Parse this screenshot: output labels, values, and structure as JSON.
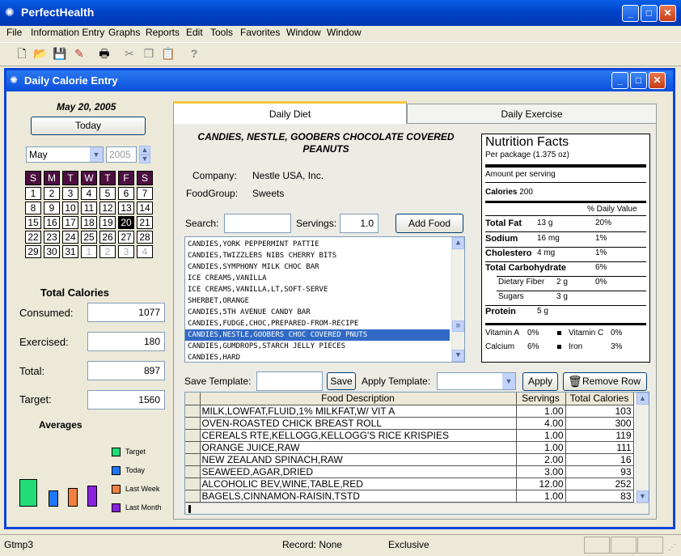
{
  "app": {
    "title": "PerfectHealth"
  },
  "menu": [
    "File",
    "Information Entry",
    "Graphs",
    "Reports",
    "Edit",
    "Tools",
    "Favorites",
    "Window",
    "Window"
  ],
  "child": {
    "title": "Daily Calorie Entry"
  },
  "date": {
    "label": "May 20, 2005",
    "today_button": "Today",
    "month": "May",
    "year": "2005"
  },
  "calendar": {
    "days_header": [
      "S",
      "M",
      "T",
      "W",
      "T",
      "F",
      "S"
    ],
    "weeks": [
      [
        "1",
        "2",
        "3",
        "4",
        "5",
        "6",
        "7"
      ],
      [
        "8",
        "9",
        "10",
        "11",
        "12",
        "13",
        "14"
      ],
      [
        "15",
        "16",
        "17",
        "18",
        "19",
        "20",
        "21"
      ],
      [
        "22",
        "23",
        "24",
        "25",
        "26",
        "27",
        "28"
      ],
      [
        "29",
        "30",
        "31",
        "1",
        "2",
        "3",
        "4"
      ]
    ],
    "selected": "20"
  },
  "totals": {
    "heading": "Total Calories",
    "consumed_label": "Consumed:",
    "consumed": "1077",
    "exercised_label": "Exercised:",
    "exercised": "180",
    "total_label": "Total:",
    "total": "897",
    "target_label": "Target:",
    "target": "1560"
  },
  "averages": {
    "heading": "Averages",
    "legend": [
      {
        "label": "Target",
        "color": "#22dd77"
      },
      {
        "label": "Today",
        "color": "#1e78ff"
      },
      {
        "label": "Last Week",
        "color": "#f08040"
      },
      {
        "label": "Last Month",
        "color": "#8822dd"
      }
    ],
    "levels": [
      1.0,
      0.6,
      0.69,
      0.77
    ]
  },
  "tabs": [
    "Daily Diet",
    "Daily Exercise"
  ],
  "food": {
    "name": "CANDIES, NESTLE, GOOBERS CHOCOLATE COVERED PEANUTS",
    "company_label": "Company:",
    "company": "Nestle USA, Inc.",
    "foodgroup_label": "FoodGroup:",
    "foodgroup": "Sweets"
  },
  "search": {
    "label": "Search:",
    "value": "",
    "servings_label": "Servings:",
    "servings": "1.0",
    "add_button": "Add Food"
  },
  "food_list": [
    "CANDIES,YORK PEPPERMINT PATTIE",
    "CANDIES,TWIZZLERS NIBS CHERRY BITS",
    "CANDIES,SYMPHONY MILK CHOC BAR",
    "ICE CREAMS,VANILLA",
    "ICE CREAMS,VANILLA,LT,SOFT-SERVE",
    "SHERBET,ORANGE",
    "CANDIES,5TH AVENUE CANDY BAR",
    "CANDIES,FUDGE,CHOC,PREPARED-FROM-RECIPE",
    "CANDIES,NESTLE,GOOBERS CHOC COVERED PNUTS",
    "CANDIES,GUMDROPS,STARCH JELLY PIECES",
    "CANDIES,HARD"
  ],
  "food_list_selected": 8,
  "nutrition": {
    "title": "Nutrition Facts",
    "per_package": "Per package (1.375 oz)",
    "amount_per": "Amount per serving",
    "calories_label": "Calories",
    "calories": "200",
    "dv_header": "% Daily Value",
    "rows": [
      {
        "label": "Total Fat",
        "amount": "13 g",
        "dv": "20%",
        "bold": true,
        "indent": false
      },
      {
        "label": "Sodium",
        "amount": "16 mg",
        "dv": "1%",
        "bold": true,
        "indent": false
      },
      {
        "label": "Cholestero",
        "amount": "4 mg",
        "dv": "1%",
        "bold": true,
        "indent": false
      },
      {
        "label": "Total Carbohydrate",
        "amount": "",
        "dv": "6%",
        "bold": true,
        "indent": false
      },
      {
        "label": "Dietary Fiber",
        "amount": "2 g",
        "dv": "0%",
        "bold": false,
        "indent": true
      },
      {
        "label": "Sugars",
        "amount": "3 g",
        "dv": "",
        "bold": false,
        "indent": true
      },
      {
        "label": "Protein",
        "amount": "5 g",
        "dv": "",
        "bold": true,
        "indent": false
      }
    ],
    "vitamins": [
      {
        "label": "Vitamin A",
        "value": "0%"
      },
      {
        "label": "Vitamin C",
        "value": "0%"
      },
      {
        "label": "Calcium",
        "value": "6%"
      },
      {
        "label": "Iron",
        "value": "3%"
      }
    ]
  },
  "template": {
    "save_label": "Save Template:",
    "save_value": "",
    "save_button": "Save",
    "apply_label": "Apply Template:",
    "apply_value": "",
    "apply_button": "Apply",
    "remove_button": "Remove Row"
  },
  "grid": {
    "headers": [
      "Food Description",
      "Servings",
      "Total Calories"
    ],
    "rows": [
      [
        "MILK,LOWFAT,FLUID,1% MILKFAT,W/ VIT A",
        "1.00",
        "103"
      ],
      [
        "OVEN-ROASTED CHICK BREAST ROLL",
        "4.00",
        "300"
      ],
      [
        "CEREALS RTE,KELLOGG,KELLOGG'S RICE KRISPIES",
        "1.00",
        "119"
      ],
      [
        "ORANGE JUICE,RAW",
        "1.00",
        "111"
      ],
      [
        "NEW ZEALAND SPINACH,RAW",
        "2.00",
        "16"
      ],
      [
        "SEAWEED,AGAR,DRIED",
        "3.00",
        "93"
      ],
      [
        "ALCOHOLIC BEV,WINE,TABLE,RED",
        "12.00",
        "252"
      ],
      [
        "BAGELS,CINNAMON-RAISIN,TSTD",
        "1.00",
        "83"
      ]
    ]
  },
  "status": {
    "left": "Gtmp3",
    "record": "Record: None",
    "mode": "Exclusive"
  }
}
